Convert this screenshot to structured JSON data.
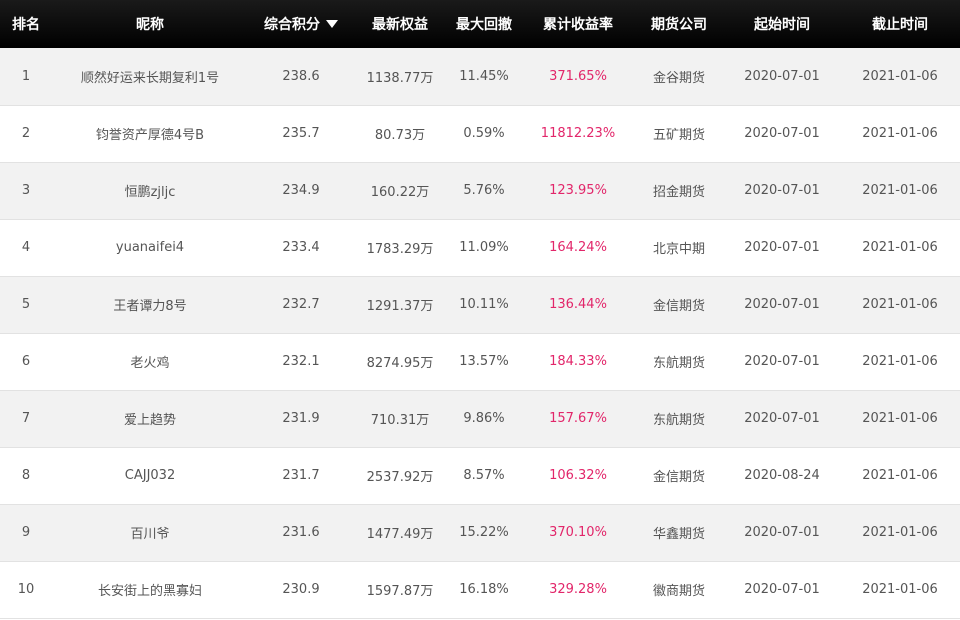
{
  "table": {
    "headers": {
      "rank": "排名",
      "nickname": "昵称",
      "score": "综合积分",
      "equity": "最新权益",
      "drawdown": "最大回撤",
      "return": "累计收益率",
      "company": "期货公司",
      "start": "起始时间",
      "end": "截止时间"
    },
    "sort_icon": "caret-down-icon",
    "accent_color": "#e2266a",
    "rows": [
      {
        "rank": "1",
        "nickname": "顺然好运来长期复利1号",
        "score": "238.6",
        "equity": "1138.77万",
        "drawdown": "11.45%",
        "return": "371.65%",
        "company": "金谷期货",
        "start": "2020-07-01",
        "end": "2021-01-06"
      },
      {
        "rank": "2",
        "nickname": "钧誉资产厚德4号B",
        "score": "235.7",
        "equity": "80.73万",
        "drawdown": "0.59%",
        "return": "11812.23%",
        "company": "五矿期货",
        "start": "2020-07-01",
        "end": "2021-01-06"
      },
      {
        "rank": "3",
        "nickname": "恒鹏zjljc",
        "score": "234.9",
        "equity": "160.22万",
        "drawdown": "5.76%",
        "return": "123.95%",
        "company": "招金期货",
        "start": "2020-07-01",
        "end": "2021-01-06"
      },
      {
        "rank": "4",
        "nickname": "yuanaifei4",
        "score": "233.4",
        "equity": "1783.29万",
        "drawdown": "11.09%",
        "return": "164.24%",
        "company": "北京中期",
        "start": "2020-07-01",
        "end": "2021-01-06"
      },
      {
        "rank": "5",
        "nickname": "王者谭力8号",
        "score": "232.7",
        "equity": "1291.37万",
        "drawdown": "10.11%",
        "return": "136.44%",
        "company": "金信期货",
        "start": "2020-07-01",
        "end": "2021-01-06"
      },
      {
        "rank": "6",
        "nickname": "老火鸡",
        "score": "232.1",
        "equity": "8274.95万",
        "drawdown": "13.57%",
        "return": "184.33%",
        "company": "东航期货",
        "start": "2020-07-01",
        "end": "2021-01-06"
      },
      {
        "rank": "7",
        "nickname": "爱上趋势",
        "score": "231.9",
        "equity": "710.31万",
        "drawdown": "9.86%",
        "return": "157.67%",
        "company": "东航期货",
        "start": "2020-07-01",
        "end": "2021-01-06"
      },
      {
        "rank": "8",
        "nickname": "CAJJ032",
        "score": "231.7",
        "equity": "2537.92万",
        "drawdown": "8.57%",
        "return": "106.32%",
        "company": "金信期货",
        "start": "2020-08-24",
        "end": "2021-01-06"
      },
      {
        "rank": "9",
        "nickname": "百川爷",
        "score": "231.6",
        "equity": "1477.49万",
        "drawdown": "15.22%",
        "return": "370.10%",
        "company": "华鑫期货",
        "start": "2020-07-01",
        "end": "2021-01-06"
      },
      {
        "rank": "10",
        "nickname": "长安街上的黑寡妇",
        "score": "230.9",
        "equity": "1597.87万",
        "drawdown": "16.18%",
        "return": "329.28%",
        "company": "徽商期货",
        "start": "2020-07-01",
        "end": "2021-01-06"
      }
    ]
  }
}
